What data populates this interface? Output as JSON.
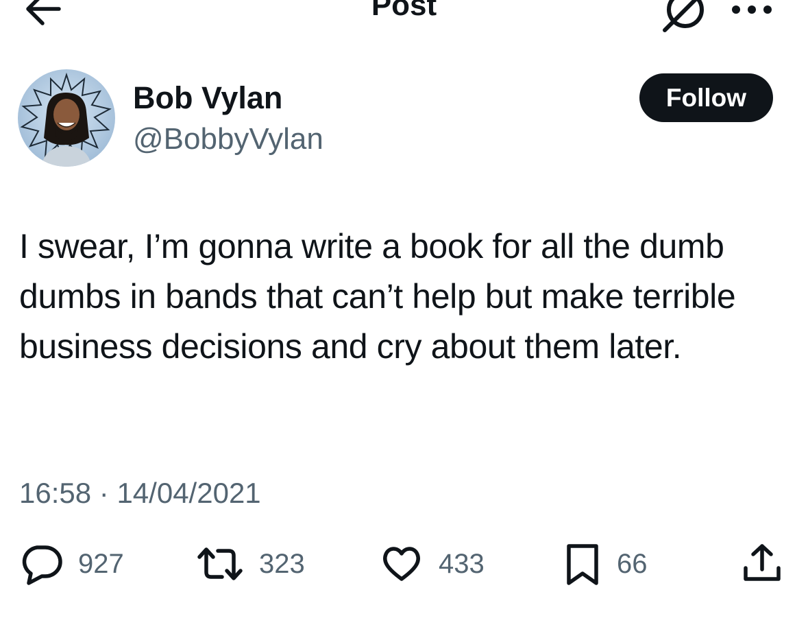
{
  "header": {
    "title": "Post",
    "back_icon": "arrow-left-icon",
    "grok_icon": "grok-icon",
    "more_icon": "more-dots-icon"
  },
  "author": {
    "name": "Bob Vylan",
    "handle": "@BobbyVylan",
    "avatar_icon": "avatar-photo"
  },
  "follow_button": {
    "label": "Follow"
  },
  "post": {
    "text": "I swear, I’m gonna write a book for all the dumb dumbs in bands that can’t help but make terrible business decisions and cry about them later.",
    "time": "16:58",
    "separator": "·",
    "date": "14/04/2021"
  },
  "actions": {
    "replies": {
      "icon": "reply-icon",
      "count": "927"
    },
    "reposts": {
      "icon": "repost-icon",
      "count": "323"
    },
    "likes": {
      "icon": "heart-icon",
      "count": "433"
    },
    "bookmarks": {
      "icon": "bookmark-icon",
      "count": "66"
    },
    "share": {
      "icon": "share-icon"
    }
  },
  "colors": {
    "text_primary": "#0f1419",
    "text_secondary": "#536471",
    "follow_button_bg": "#0f1419",
    "follow_button_text": "#ffffff"
  }
}
